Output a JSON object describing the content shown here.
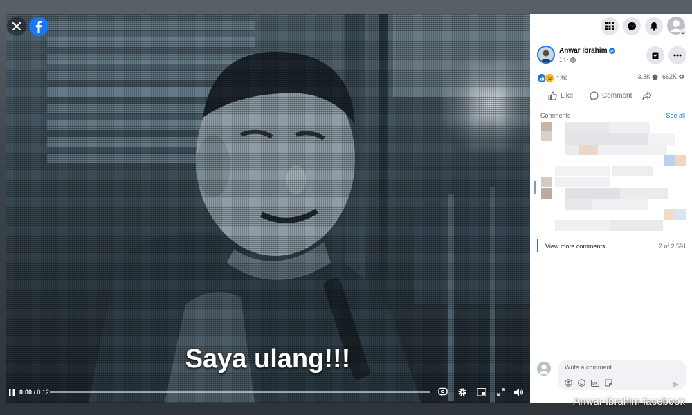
{
  "video": {
    "subtitle": "Saya ulang!!!",
    "time_current": "0:00",
    "time_separator": " / ",
    "time_total": "0:12",
    "progress": 0.0
  },
  "post": {
    "author": "Anwar Ibrahim",
    "time": "1h",
    "reactions_count": "13K",
    "comments_count": "3.3K",
    "views_count": "662K"
  },
  "actions": {
    "like": "Like",
    "comment": "Comment"
  },
  "comments": {
    "header": "Comments",
    "see_all": "See all",
    "view_more": "View more comments",
    "count_label": "2 of 2,591"
  },
  "composer": {
    "placeholder": "Write a comment..."
  },
  "credit": "Anwar Ibrahim facebook",
  "colors": {
    "brand": "#1877f2",
    "panel_bg": "#ffffff",
    "video_bg": "#0d1216"
  }
}
